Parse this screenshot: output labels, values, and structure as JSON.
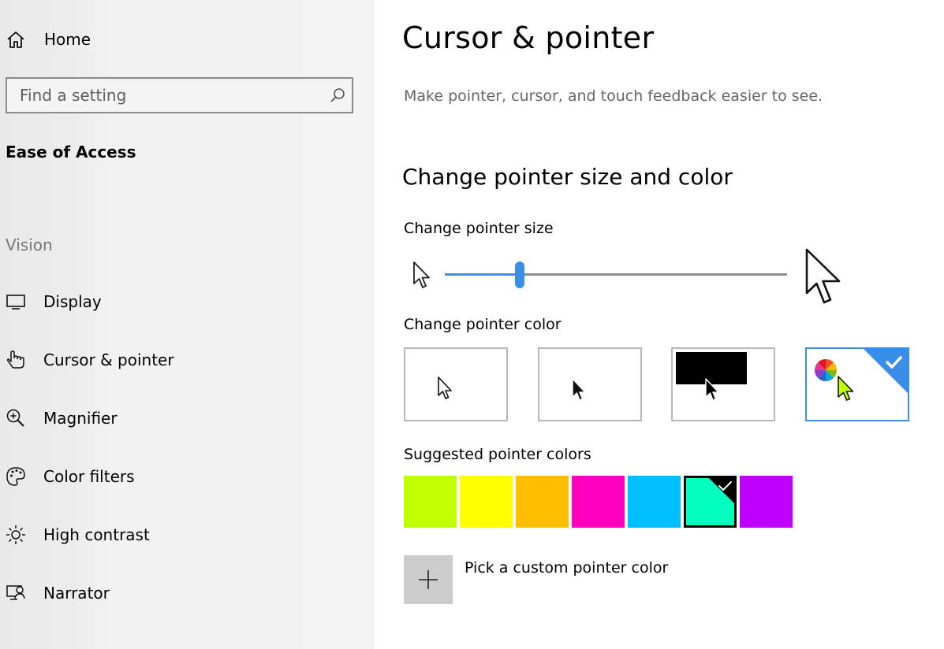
{
  "sidebar": {
    "home_label": "Home",
    "search": {
      "placeholder": "Find a setting"
    },
    "section_title": "Ease of Access",
    "group_title": "Vision",
    "items": [
      {
        "label": "Display",
        "icon": "monitor-icon"
      },
      {
        "label": "Cursor & pointer",
        "icon": "pointer-hand-icon"
      },
      {
        "label": "Magnifier",
        "icon": "magnifier-icon"
      },
      {
        "label": "Color filters",
        "icon": "palette-icon"
      },
      {
        "label": "High contrast",
        "icon": "sun-icon"
      },
      {
        "label": "Narrator",
        "icon": "narrator-icon"
      }
    ]
  },
  "main": {
    "title": "Cursor & pointer",
    "description": "Make pointer, cursor, and touch feedback easier to see.",
    "subtitle": "Change pointer size and color",
    "pointer_size": {
      "label": "Change pointer size",
      "value_fraction": 0.22
    },
    "pointer_color": {
      "label": "Change pointer color",
      "options": [
        {
          "name": "white",
          "selected": false
        },
        {
          "name": "black",
          "selected": false
        },
        {
          "name": "inverted",
          "selected": false
        },
        {
          "name": "custom",
          "selected": true
        }
      ]
    },
    "suggested": {
      "label": "Suggested pointer colors",
      "colors": [
        "#bfff00",
        "#ffff00",
        "#ffbf00",
        "#ff00bf",
        "#00bfff",
        "#00ffbf",
        "#bf00ff"
      ],
      "selected_index": 5
    },
    "custom_color_label": "Pick a custom pointer color",
    "accent_color": "#3b8ee8"
  }
}
